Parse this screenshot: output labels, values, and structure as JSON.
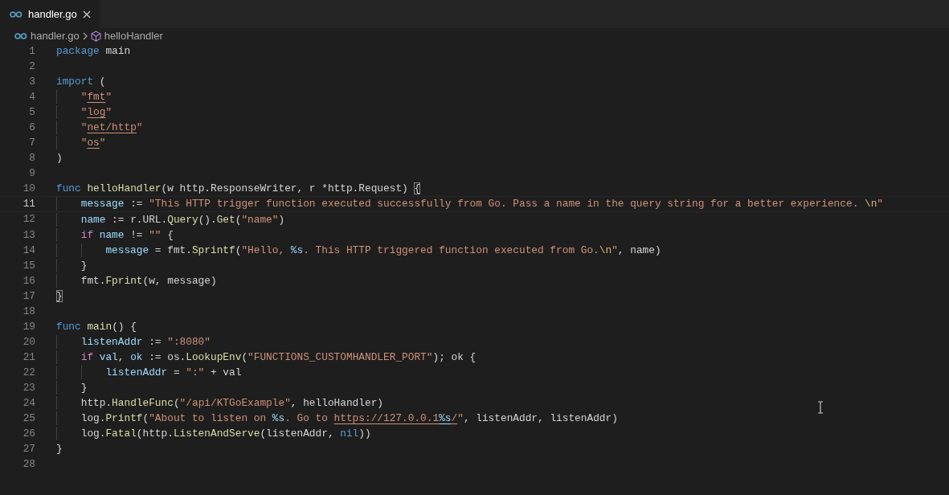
{
  "tab": {
    "label": "handler.go",
    "selected": true
  },
  "breadcrumb": [
    {
      "label": "handler.go",
      "kind": "file"
    },
    {
      "label": "helloHandler",
      "kind": "function"
    }
  ],
  "lines": [
    {
      "number": "1",
      "selected": false,
      "tokens": [
        {
          "text": "package",
          "kind": "keyword"
        },
        {
          "text": " main",
          "kind": "plain"
        }
      ]
    },
    {
      "number": "2",
      "selected": false
    },
    {
      "number": "3",
      "selected": false,
      "tokens": [
        {
          "text": "import",
          "kind": "keyword"
        },
        {
          "text": " (",
          "kind": "plain"
        }
      ]
    },
    {
      "number": "4",
      "selected": false,
      "tokens": [
        {
          "text": "    \"",
          "kind": "string"
        },
        {
          "text": "fmt",
          "kind": "link"
        },
        {
          "text": "\"",
          "kind": "string"
        }
      ]
    },
    {
      "number": "5",
      "selected": false,
      "tokens": [
        {
          "text": "    \"",
          "kind": "string"
        },
        {
          "text": "log",
          "kind": "link"
        },
        {
          "text": "\"",
          "kind": "string"
        }
      ]
    },
    {
      "number": "6",
      "selected": false,
      "tokens": [
        {
          "text": "    \"",
          "kind": "string"
        },
        {
          "text": "net/http",
          "kind": "link"
        },
        {
          "text": "\"",
          "kind": "string"
        }
      ]
    },
    {
      "number": "7",
      "selected": false,
      "tokens": [
        {
          "text": "    \"",
          "kind": "string"
        },
        {
          "text": "os",
          "kind": "link"
        },
        {
          "text": "\"",
          "kind": "string"
        }
      ]
    },
    {
      "number": "8",
      "selected": false,
      "tokens": [
        {
          "text": ")",
          "kind": "plain"
        }
      ]
    },
    {
      "number": "9",
      "selected": false
    },
    {
      "number": "10",
      "selected": false,
      "tokens": [
        {
          "text": "func",
          "kind": "keyword"
        },
        {
          "text": " helloHandler",
          "kind": "function"
        },
        {
          "text": "(w http.ResponseWriter, r *http.Request) ",
          "kind": "plain"
        },
        {
          "text": "{",
          "kind": "bracket-match"
        }
      ]
    },
    {
      "number": "11",
      "selected": true,
      "tokens": [
        {
          "text": "    message",
          "kind": "variable"
        },
        {
          "text": " := ",
          "kind": "plain"
        },
        {
          "text": "\"This HTTP trigger function executed successfully from Go. Pass a name in the query string for a better experience. ",
          "kind": "string"
        },
        {
          "text": "\\n",
          "kind": "escape"
        },
        {
          "text": "\"",
          "kind": "string"
        }
      ]
    },
    {
      "number": "12",
      "selected": false,
      "tokens": [
        {
          "text": "    name",
          "kind": "variable"
        },
        {
          "text": " := r.URL.",
          "kind": "plain"
        },
        {
          "text": "Query",
          "kind": "function"
        },
        {
          "text": "().",
          "kind": "plain"
        },
        {
          "text": "Get",
          "kind": "function"
        },
        {
          "text": "(",
          "kind": "plain"
        },
        {
          "text": "\"name\"",
          "kind": "string"
        },
        {
          "text": ")",
          "kind": "plain"
        }
      ]
    },
    {
      "number": "13",
      "selected": false,
      "tokens": [
        {
          "text": "    if",
          "kind": "control"
        },
        {
          "text": " name",
          "kind": "variable"
        },
        {
          "text": " != ",
          "kind": "plain"
        },
        {
          "text": "\"\"",
          "kind": "string"
        },
        {
          "text": " {",
          "kind": "plain"
        }
      ]
    },
    {
      "number": "14",
      "selected": false,
      "tokens": [
        {
          "text": "        message",
          "kind": "variable"
        },
        {
          "text": " = fmt.",
          "kind": "plain"
        },
        {
          "text": "Sprintf",
          "kind": "function"
        },
        {
          "text": "(",
          "kind": "plain"
        },
        {
          "text": "\"Hello, ",
          "kind": "string"
        },
        {
          "text": "%s",
          "kind": "format"
        },
        {
          "text": ". This HTTP triggered function executed from Go.",
          "kind": "string"
        },
        {
          "text": "\\n",
          "kind": "escape"
        },
        {
          "text": "\"",
          "kind": "string"
        },
        {
          "text": ", name)",
          "kind": "plain"
        }
      ]
    },
    {
      "number": "15",
      "selected": false,
      "tokens": [
        {
          "text": "    }",
          "kind": "plain"
        }
      ]
    },
    {
      "number": "16",
      "selected": false,
      "tokens": [
        {
          "text": "    fmt.",
          "kind": "plain"
        },
        {
          "text": "Fprint",
          "kind": "function"
        },
        {
          "text": "(w, message)",
          "kind": "plain"
        }
      ]
    },
    {
      "number": "17",
      "selected": false,
      "tokens": [
        {
          "text": "}",
          "kind": "bracket-match"
        }
      ]
    },
    {
      "number": "18",
      "selected": false
    },
    {
      "number": "19",
      "selected": false,
      "tokens": [
        {
          "text": "func",
          "kind": "keyword"
        },
        {
          "text": " main",
          "kind": "function"
        },
        {
          "text": "() {",
          "kind": "plain"
        }
      ]
    },
    {
      "number": "20",
      "selected": false,
      "tokens": [
        {
          "text": "    listenAddr",
          "kind": "variable"
        },
        {
          "text": " := ",
          "kind": "plain"
        },
        {
          "text": "\":8080\"",
          "kind": "string"
        }
      ]
    },
    {
      "number": "21",
      "selected": false,
      "tokens": [
        {
          "text": "    if",
          "kind": "control"
        },
        {
          "text": " val",
          "kind": "variable"
        },
        {
          "text": ", ",
          "kind": "plain"
        },
        {
          "text": "ok",
          "kind": "variable"
        },
        {
          "text": " := os.",
          "kind": "plain"
        },
        {
          "text": "LookupEnv",
          "kind": "function"
        },
        {
          "text": "(",
          "kind": "plain"
        },
        {
          "text": "\"FUNCTIONS_CUSTOMHANDLER_PORT\"",
          "kind": "string"
        },
        {
          "text": "); ok {",
          "kind": "plain"
        }
      ]
    },
    {
      "number": "22",
      "selected": false,
      "tokens": [
        {
          "text": "        listenAddr",
          "kind": "variable"
        },
        {
          "text": " = ",
          "kind": "plain"
        },
        {
          "text": "\":\"",
          "kind": "string"
        },
        {
          "text": " + val",
          "kind": "plain"
        }
      ]
    },
    {
      "number": "23",
      "selected": false,
      "tokens": [
        {
          "text": "    }",
          "kind": "plain"
        }
      ]
    },
    {
      "number": "24",
      "selected": false,
      "tokens": [
        {
          "text": "    http.",
          "kind": "plain"
        },
        {
          "text": "HandleFunc",
          "kind": "function"
        },
        {
          "text": "(",
          "kind": "plain"
        },
        {
          "text": "\"/api/KTGoExample\"",
          "kind": "string"
        },
        {
          "text": ", helloHandler)",
          "kind": "plain"
        }
      ]
    },
    {
      "number": "25",
      "selected": false,
      "tokens": [
        {
          "text": "    log.",
          "kind": "plain"
        },
        {
          "text": "Printf",
          "kind": "function"
        },
        {
          "text": "(",
          "kind": "plain"
        },
        {
          "text": "\"About to listen on ",
          "kind": "string"
        },
        {
          "text": "%s",
          "kind": "format"
        },
        {
          "text": ". Go to ",
          "kind": "string"
        },
        {
          "text": "https://127.0.0.1",
          "kind": "link"
        },
        {
          "text": "%s",
          "kind": "format-link"
        },
        {
          "text": "/",
          "kind": "link"
        },
        {
          "text": "\"",
          "kind": "string"
        },
        {
          "text": ", listenAddr, listenAddr)",
          "kind": "plain"
        }
      ]
    },
    {
      "number": "26",
      "selected": false,
      "tokens": [
        {
          "text": "    log.",
          "kind": "plain"
        },
        {
          "text": "Fatal",
          "kind": "function"
        },
        {
          "text": "(http.",
          "kind": "plain"
        },
        {
          "text": "ListenAndServe",
          "kind": "function"
        },
        {
          "text": "(listenAddr, ",
          "kind": "plain"
        },
        {
          "text": "nil",
          "kind": "keyword"
        },
        {
          "text": "))",
          "kind": "plain"
        }
      ]
    },
    {
      "number": "27",
      "selected": false,
      "tokens": [
        {
          "text": "}",
          "kind": "plain"
        }
      ]
    },
    {
      "number": "28",
      "selected": false
    }
  ]
}
